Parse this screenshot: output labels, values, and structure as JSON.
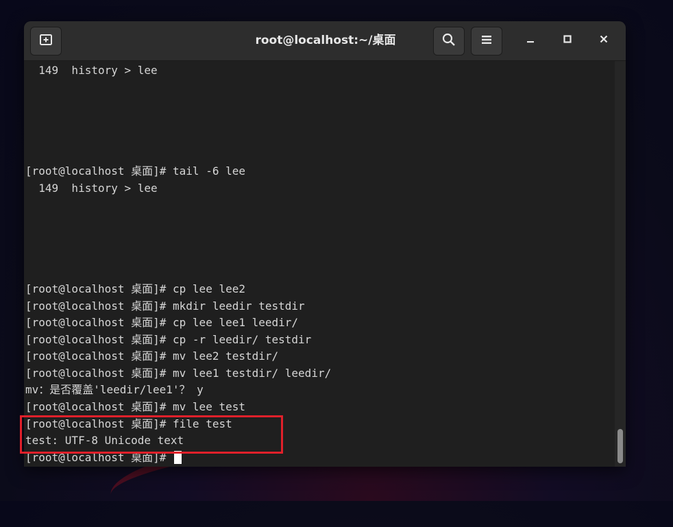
{
  "window": {
    "title": "root@localhost:~/桌面"
  },
  "icons": {
    "new_tab": "new-tab-icon",
    "search": "search-icon",
    "menu": "hamburger-menu-icon",
    "minimize": "minimize-icon",
    "maximize": "maximize-icon",
    "close": "close-icon"
  },
  "terminal": {
    "lines": [
      "  149  history > lee",
      "[root@localhost 桌面]# tail -6 lee",
      "  149  history > lee",
      "[root@localhost 桌面]# cp lee lee2",
      "[root@localhost 桌面]# mkdir leedir testdir",
      "[root@localhost 桌面]# cp lee lee1 leedir/",
      "[root@localhost 桌面]# cp -r leedir/ testdir",
      "[root@localhost 桌面]# mv lee2 testdir/",
      "[root@localhost 桌面]# mv lee1 testdir/ leedir/",
      "mv：是否覆盖'leedir/lee1'？ y",
      "[root@localhost 桌面]# mv lee test",
      "[root@localhost 桌面]# file test",
      "test: UTF-8 Unicode text",
      "[root@localhost 桌面]# "
    ]
  },
  "colors": {
    "highlight_box": "#e0202a",
    "terminal_bg": "#1f1f1f",
    "terminal_fg": "#d6d6d6"
  }
}
